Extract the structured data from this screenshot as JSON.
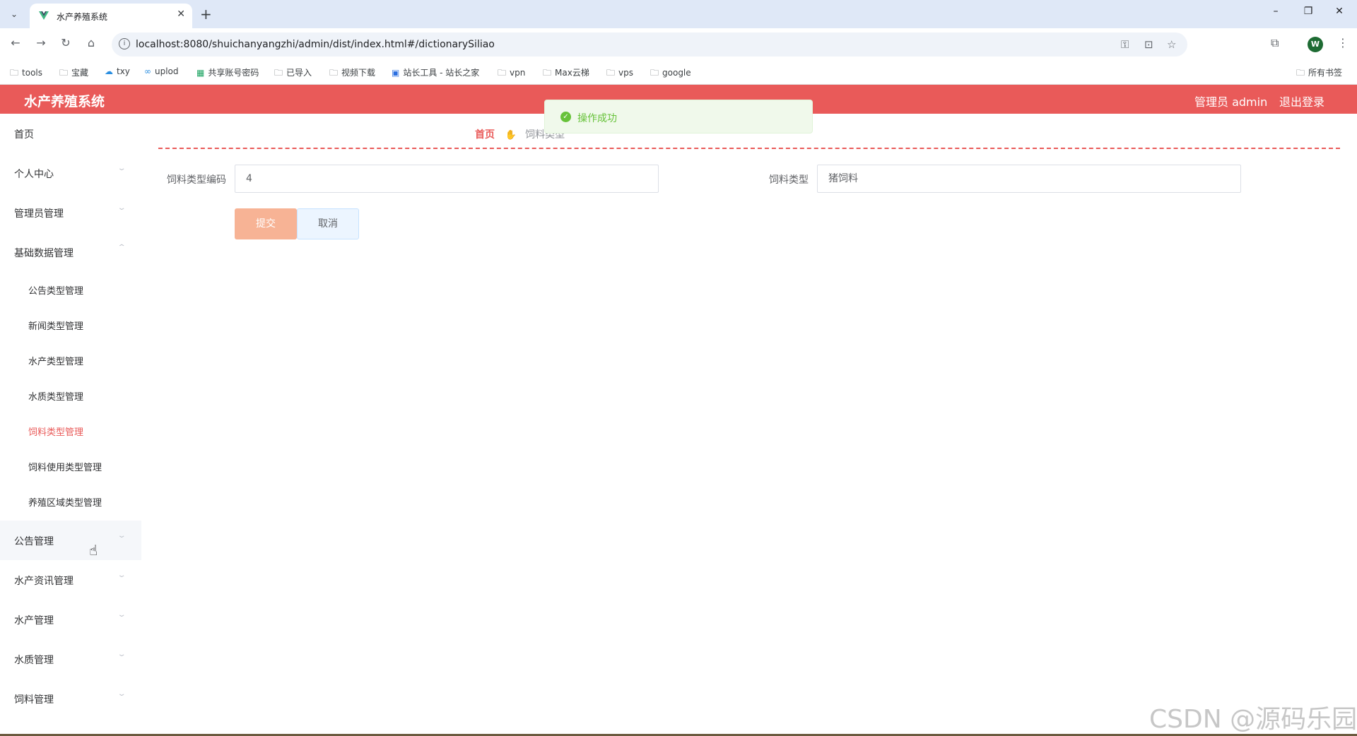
{
  "browser": {
    "tab_title": "水产养殖系统",
    "url": "localhost:8080/shuichanyangzhi/admin/dist/index.html#/dictionarySiliao",
    "profile_initial": "W",
    "bookmarks": [
      "tools",
      "宝藏",
      "txy",
      "uplod",
      "共享账号密码",
      "已导入",
      "视频下载",
      "站长工具 - 站长之家",
      "vpn",
      "Max云梯",
      "vps",
      "google"
    ],
    "all_bookmarks": "所有书签"
  },
  "header": {
    "title": "水产养殖系统",
    "user": "管理员 admin",
    "logout": "退出登录"
  },
  "sidebar": {
    "items": [
      {
        "label": "首页"
      },
      {
        "label": "个人中心"
      },
      {
        "label": "管理员管理"
      },
      {
        "label": "基础数据管理"
      },
      {
        "label": "公告管理"
      },
      {
        "label": "水产资讯管理"
      },
      {
        "label": "水产管理"
      },
      {
        "label": "水质管理"
      },
      {
        "label": "饲料管理"
      }
    ],
    "sub_items": [
      {
        "label": "公告类型管理"
      },
      {
        "label": "新闻类型管理"
      },
      {
        "label": "水产类型管理"
      },
      {
        "label": "水质类型管理"
      },
      {
        "label": "饲料类型管理"
      },
      {
        "label": "饲料使用类型管理"
      },
      {
        "label": "养殖区域类型管理"
      }
    ]
  },
  "breadcrumb": {
    "home": "首页",
    "current": "饲料类型"
  },
  "form": {
    "code_label": "饲料类型编码",
    "code_value": "4",
    "type_label": "饲料类型",
    "type_value": "猪饲料",
    "submit": "提交",
    "cancel": "取消"
  },
  "toast": {
    "message": "操作成功"
  },
  "watermark": "CSDN @源码乐园",
  "colors": {
    "accent": "#e95a59",
    "submit": "#f7b395",
    "success": "#67c23a"
  }
}
